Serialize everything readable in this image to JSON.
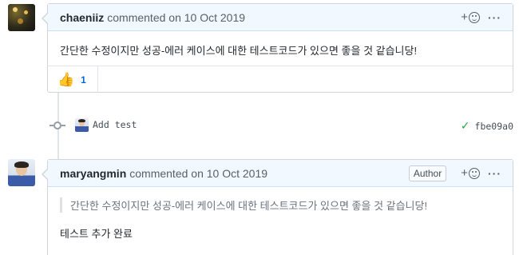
{
  "comments": [
    {
      "author": "chaeniiz",
      "meta": "commented on 10 Oct 2019",
      "body": "간단한 수정이지만 성공-에러 케이스에 대한 테스트코드가 있으면 좋을 것 같습니당!",
      "reactions": [
        {
          "emoji": "👍",
          "count": "1"
        }
      ]
    },
    {
      "author": "maryangmin",
      "meta": "commented on 10 Oct 2019",
      "badge": "Author",
      "quote": "간단한 수정이지만 성공-에러 케이스에 대한 테스트코드가 있으면 좋을 것 같습니당!",
      "body": "테스트 추가 완료"
    }
  ],
  "commit": {
    "message": "Add test",
    "sha": "fbe09a0",
    "status": "success"
  },
  "actions": {
    "add_reaction": "+",
    "more": "···"
  },
  "colors": {
    "header_bg": "#f1f8ff",
    "header_border": "#c8e1ff",
    "link_blue": "#0366d6",
    "success_green": "#28a745"
  }
}
